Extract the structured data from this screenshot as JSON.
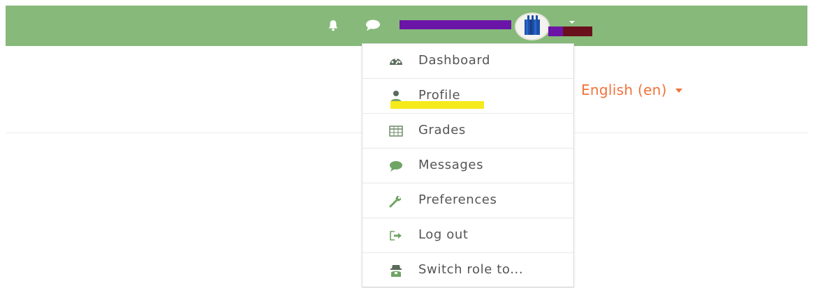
{
  "header": {
    "bell_icon": "bell-icon",
    "chat_icon": "chat-icon",
    "user_name_redacted": "",
    "avatar_icon": "avatar",
    "colors": {
      "bar": "#86b97a",
      "redaction_purple": "#6b14a8",
      "redaction_maroon": "#6a0f1c"
    }
  },
  "language": {
    "label": "English (en)",
    "color": "#f0733a"
  },
  "user_menu": {
    "items": [
      {
        "label": "Dashboard",
        "icon": "dashboard-icon"
      },
      {
        "label": "Profile",
        "icon": "user-icon"
      },
      {
        "label": "Grades",
        "icon": "table-icon"
      },
      {
        "label": "Messages",
        "icon": "chat-icon"
      },
      {
        "label": "Preferences",
        "icon": "wrench-icon"
      },
      {
        "label": "Log out",
        "icon": "sign-out-icon"
      },
      {
        "label": "Switch role to...",
        "icon": "user-secret-icon"
      }
    ]
  }
}
